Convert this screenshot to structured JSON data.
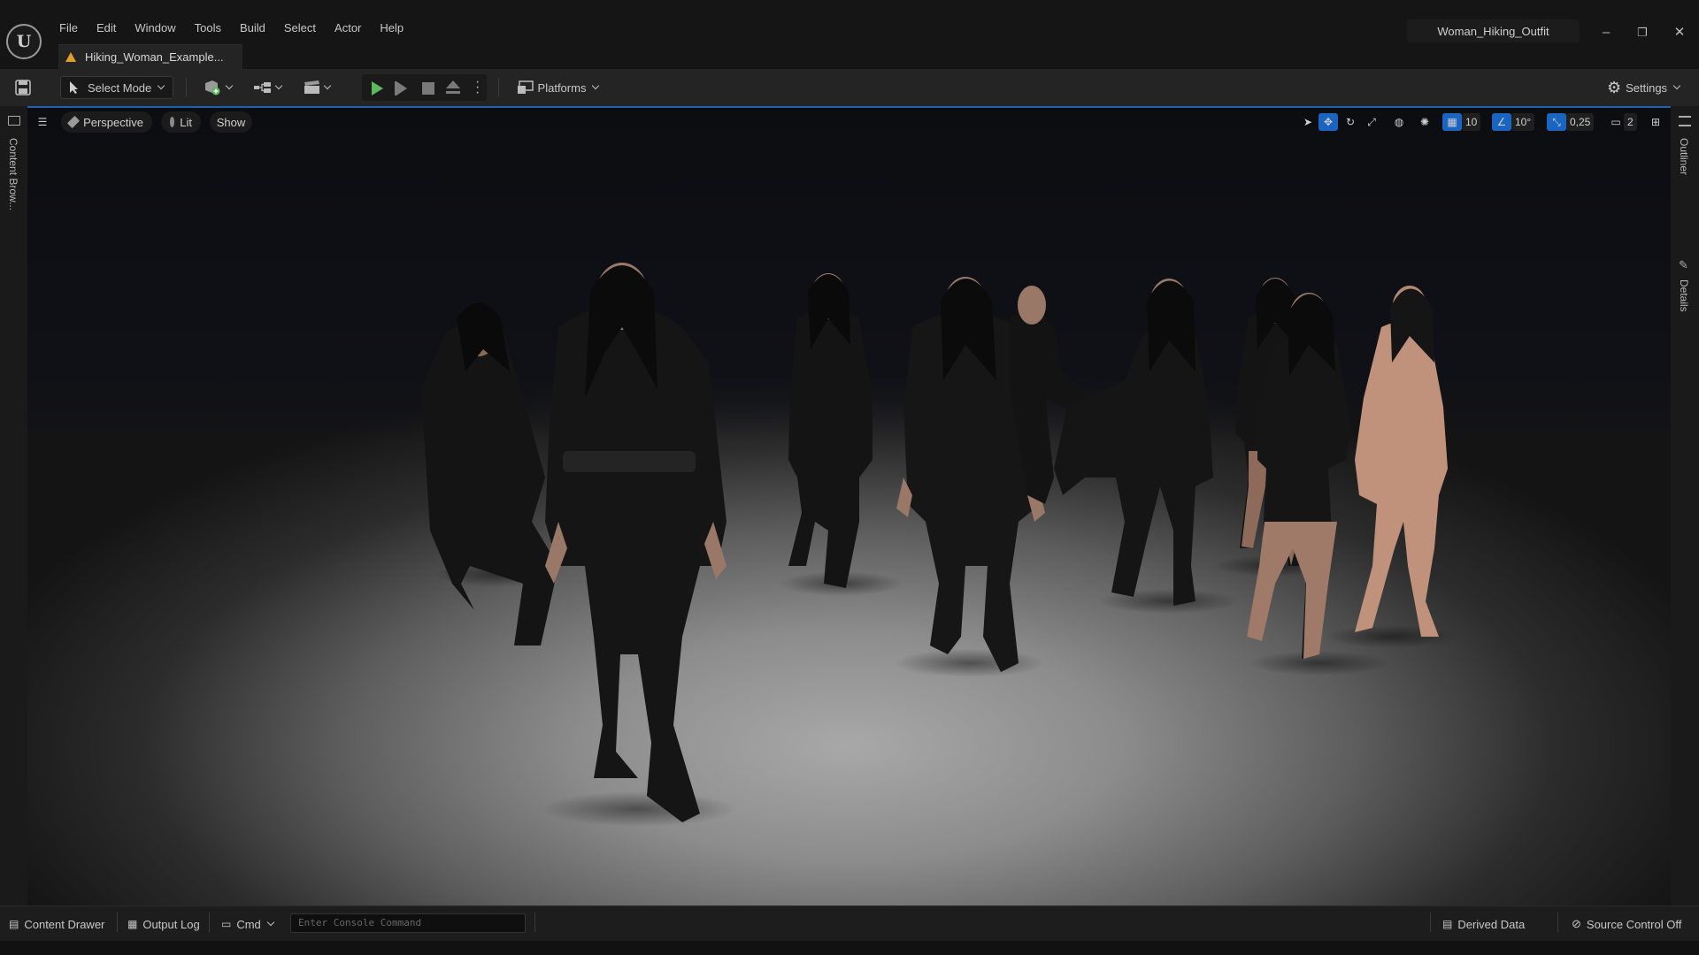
{
  "app": {
    "logo_letter": "U"
  },
  "menu": [
    "File",
    "Edit",
    "Window",
    "Tools",
    "Build",
    "Select",
    "Actor",
    "Help"
  ],
  "document_tab": {
    "label": "Hiking_Woman_Example..."
  },
  "project_name": "Woman_Hiking_Outfit",
  "window_controls": {
    "minimize": "–",
    "restore": "❐",
    "close": "✕"
  },
  "toolbar": {
    "mode_label": "Select Mode",
    "platforms_label": "Platforms",
    "settings_label": "Settings"
  },
  "viewport": {
    "perspective_label": "Perspective",
    "lit_label": "Lit",
    "show_label": "Show",
    "grid_snap": "10",
    "rotation_snap": "10°",
    "scale_snap": "0,25",
    "camera_speed": "2"
  },
  "side_panels": {
    "left": "Content Brow...",
    "outliner": "Outliner",
    "details": "Details"
  },
  "statusbar": {
    "content_drawer": "Content Drawer",
    "output_log": "Output Log",
    "cmd": "Cmd",
    "console_placeholder": "Enter Console Command",
    "derived_data": "Derived Data",
    "source_control": "Source Control Off"
  },
  "colors": {
    "accent_blue": "#1f5fae",
    "play_green": "#5cb85c",
    "warning": "#e0a030"
  }
}
